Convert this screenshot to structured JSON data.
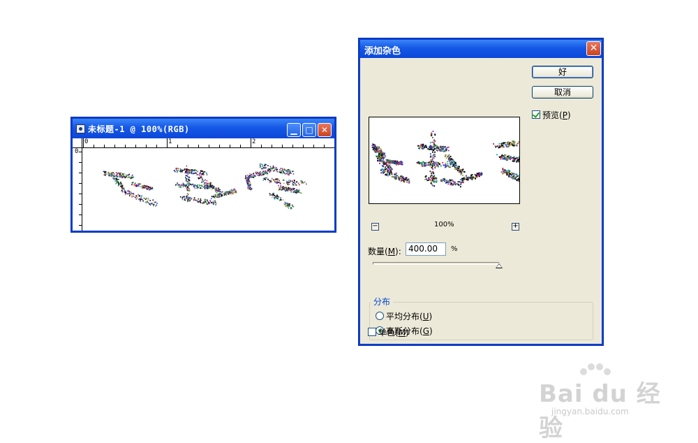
{
  "document_window": {
    "title": "未标题-1 @ 100%(RGB)",
    "ruler": {
      "horizontal_labels": [
        "0",
        "1",
        "2"
      ],
      "vertical_labels": [
        "0"
      ]
    }
  },
  "dialog": {
    "title": "添加杂色",
    "ok_label": "好",
    "cancel_label": "取消",
    "preview_label": "预览(P)",
    "preview_label_main": "预览(",
    "preview_label_key": "P",
    "preview_checked": true,
    "zoom_level": "100%",
    "zoom_minus": "−",
    "zoom_plus": "+",
    "amount_label_main": "数量(",
    "amount_label_key": "M",
    "amount_label_tail": "):",
    "amount_value": "400.00",
    "amount_unit": "%",
    "amount_slider_fraction": 1.0,
    "distribution": {
      "legend": "分布",
      "uniform_main": "平均分布(",
      "uniform_key": "U",
      "gaussian_main": "高斯分布(",
      "gaussian_key": "G",
      "selected": "gaussian"
    },
    "monochrome_main": "单色(",
    "monochrome_key": "M",
    "monochrome_checked": false
  },
  "watermark": {
    "logo": "Bai du 经验",
    "url": "jingyan.baidu.com"
  },
  "colors": {
    "titlebar": "#0c47d8",
    "dialog_face": "#ece9d8",
    "close_button": "#c9431f"
  }
}
